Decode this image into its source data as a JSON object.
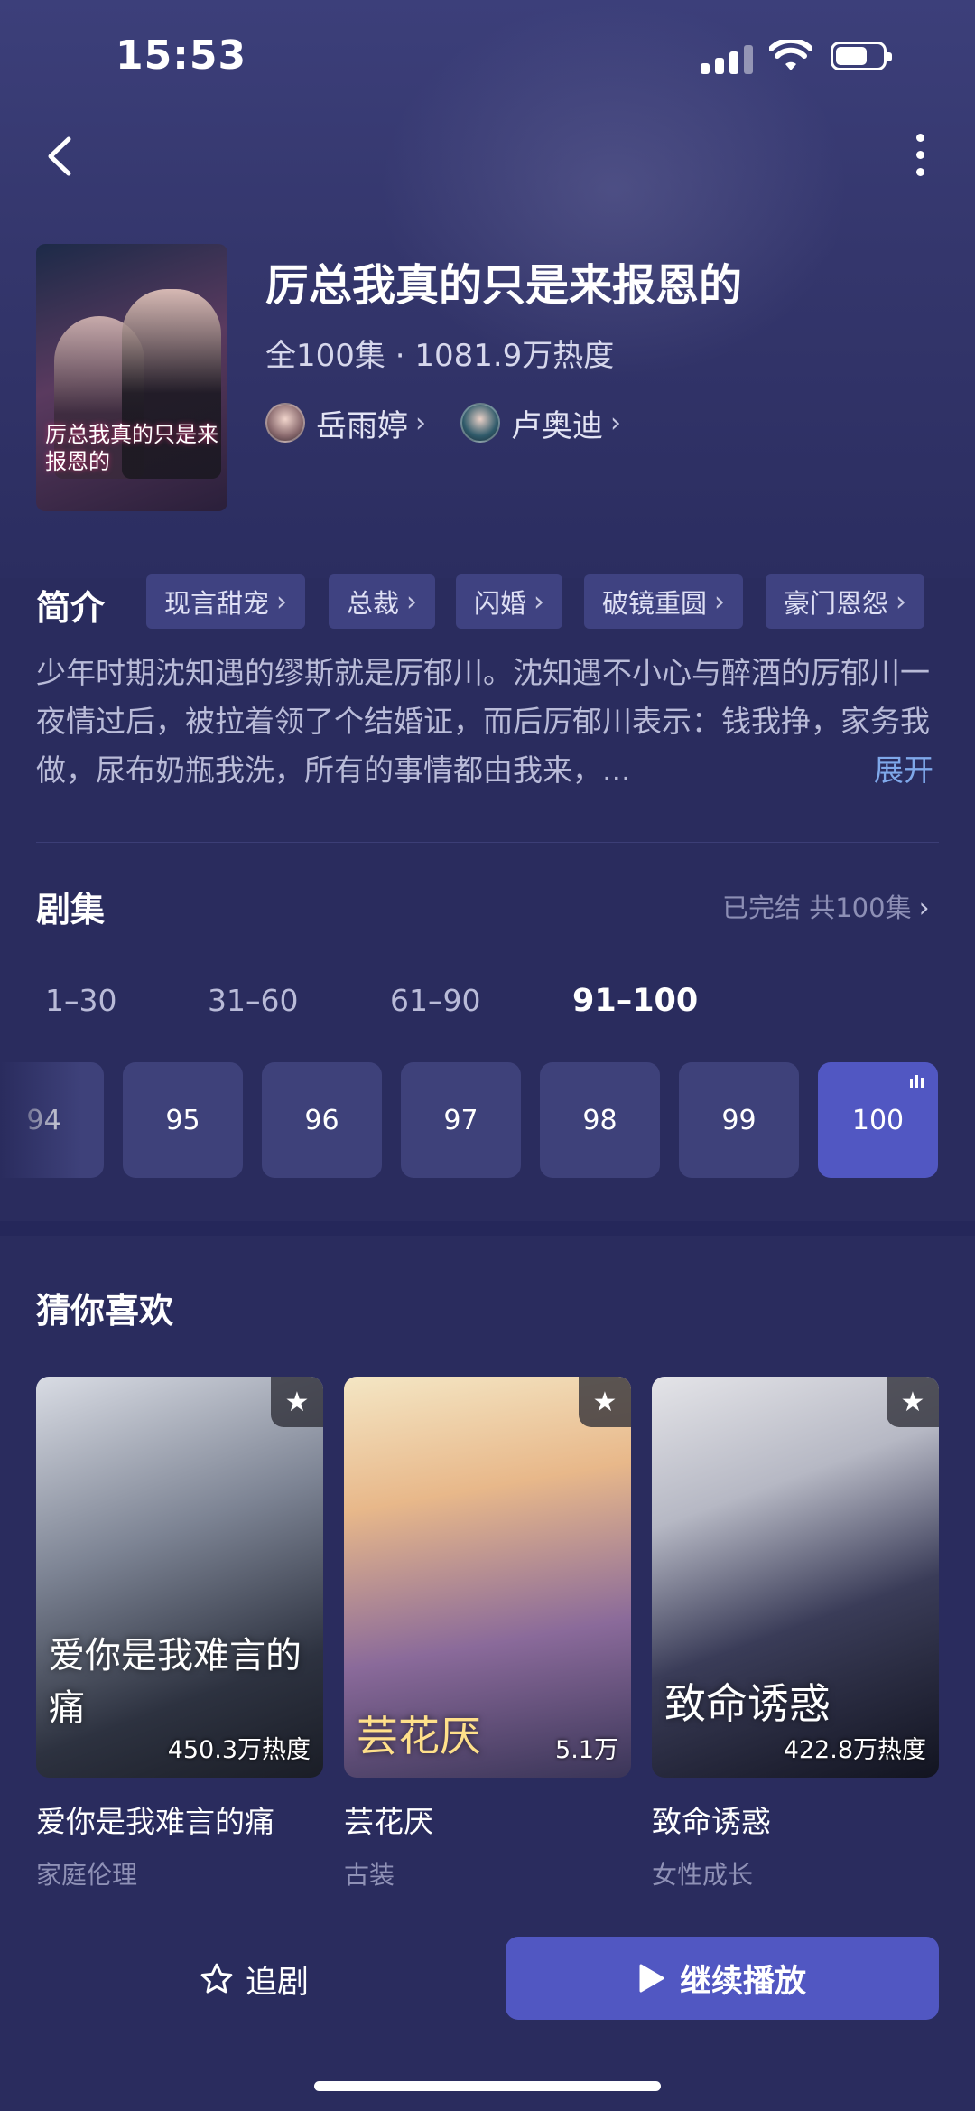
{
  "status_bar": {
    "time": "15:53"
  },
  "drama": {
    "title": "厉总我真的只是来报恩的",
    "meta": "全100集 · 1081.9万热度",
    "poster_text": "厉总我真的只是来报恩的",
    "actors": [
      {
        "name": "岳雨婷"
      },
      {
        "name": "卢奥迪"
      }
    ]
  },
  "intro": {
    "label": "简介",
    "tags": [
      "现言甜宠",
      "总裁",
      "闪婚",
      "破镜重圆",
      "豪门恩怨"
    ],
    "description": "少年时期沈知遇的缪斯就是厉郁川。沈知遇不小心与醉酒的厉郁川一夜情过后，被拉着领了个结婚证，而后厉郁川表示：钱我挣，家务我做，尿布奶瓶我洗，所有的事情都由我来，...",
    "expand": "展开"
  },
  "episodes": {
    "label": "剧集",
    "status": "已完结 共100集",
    "ranges": [
      "1–30",
      "31–60",
      "61–90",
      "91–100"
    ],
    "active_range": "91–100",
    "items": [
      "94",
      "95",
      "96",
      "97",
      "98",
      "99",
      "100"
    ],
    "current": "100"
  },
  "recommend": {
    "label": "猜你喜欢",
    "items": [
      {
        "title": "爱你是我难言的痛",
        "category": "家庭伦理",
        "cover_text": "爱你是我难言的痛",
        "heat": "450.3万热度"
      },
      {
        "title": "芸花厌",
        "category": "古装",
        "cover_text": "芸花厌",
        "heat": "5.1万"
      },
      {
        "title": "致命诱惑",
        "category": "女性成长",
        "cover_text": "致命诱惑",
        "heat": "422.8万热度"
      }
    ]
  },
  "bottom": {
    "follow": "追剧",
    "play": "继续播放"
  },
  "colors": {
    "background": "#2a2c5e",
    "accent": "#5157c2",
    "link": "#7fa8ea"
  }
}
